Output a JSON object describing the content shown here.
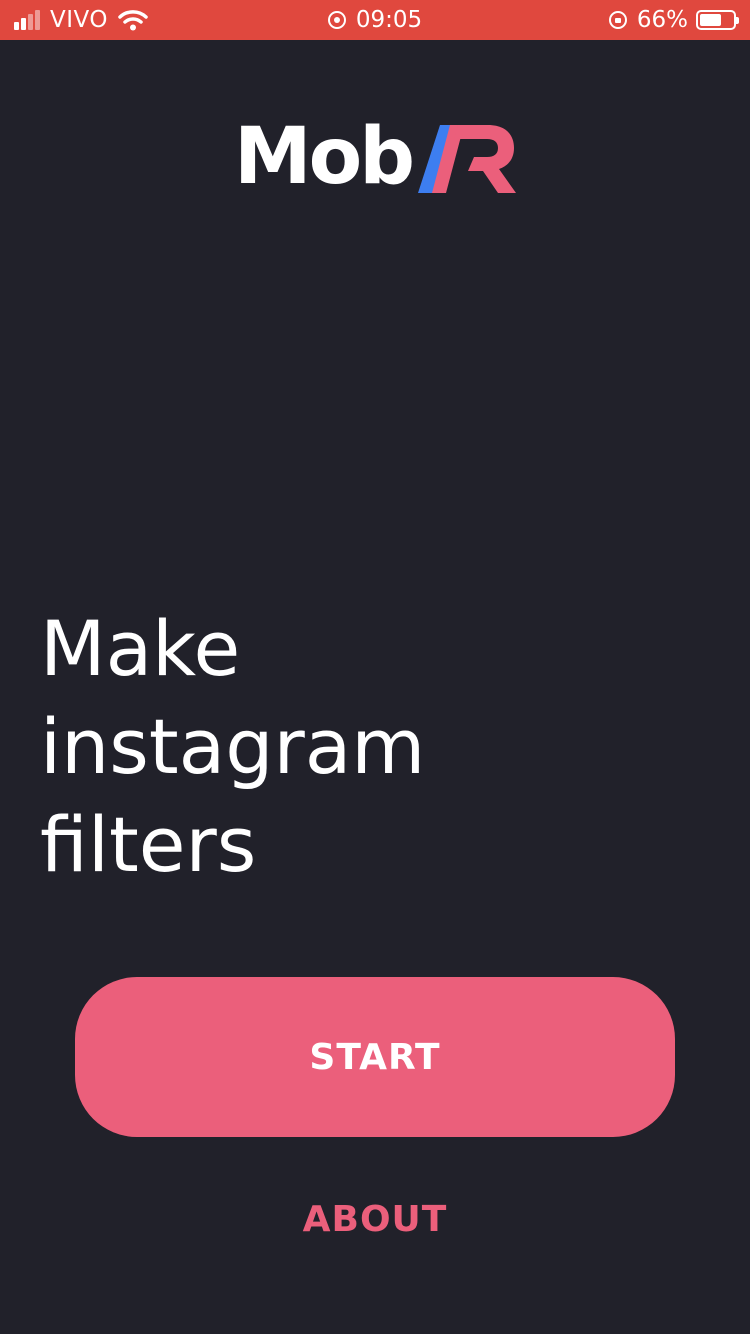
{
  "status_bar": {
    "carrier": "VIVO",
    "time": "09:05",
    "battery_percent": "66%",
    "battery_level": 0.66,
    "background_color": "#e0483e",
    "signal_bars_active": 2,
    "signal_bars_total": 4,
    "icons": [
      "signal-icon",
      "wifi-icon",
      "screen-lock-icon",
      "orientation-lock-icon",
      "battery-icon"
    ]
  },
  "logo": {
    "text": "Mob",
    "mark": "AR",
    "mark_colors": {
      "a_slash": "#3d7ef0",
      "r": "#eb5f7b"
    }
  },
  "headline": {
    "line1": "Make",
    "line2": "instagram",
    "line3": "filters"
  },
  "actions": {
    "start_label": "START",
    "about_label": "ABOUT",
    "accent_color": "#eb5f7b"
  },
  "theme": {
    "background": "#21212a",
    "text": "#ffffff"
  }
}
